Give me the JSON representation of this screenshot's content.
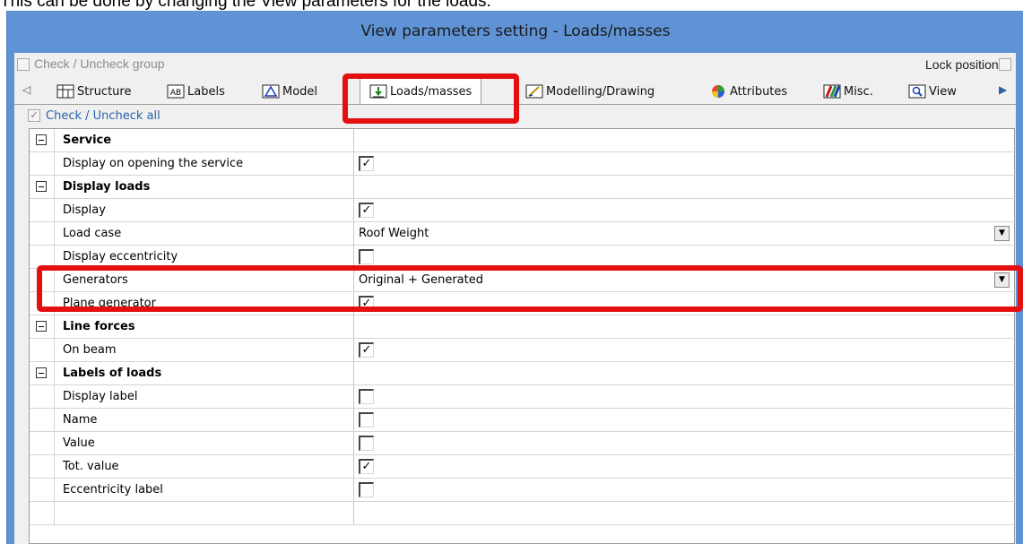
{
  "caption": "This can be done by changing the View parameters for the loads.",
  "window": {
    "title": "View parameters setting - Loads/masses"
  },
  "group_row": {
    "check_group_label": "Check / Uncheck group",
    "lock_label": "Lock position"
  },
  "tabs": [
    {
      "label": "Structure",
      "icon": "structure-icon"
    },
    {
      "label": "Labels",
      "icon": "labels-icon"
    },
    {
      "label": "Model",
      "icon": "model-icon"
    },
    {
      "label": "Loads/masses",
      "icon": "loads-icon",
      "active": true
    },
    {
      "label": "Modelling/Drawing",
      "icon": "modelling-icon"
    },
    {
      "label": "Attributes",
      "icon": "attributes-icon"
    },
    {
      "label": "Misc.",
      "icon": "misc-icon"
    },
    {
      "label": "View",
      "icon": "view-icon"
    }
  ],
  "check_all_label": "Check / Uncheck all",
  "rows": [
    {
      "label": "Service",
      "type": "section"
    },
    {
      "label": "Display on opening the service",
      "type": "checkbox",
      "checked": true
    },
    {
      "label": "Display loads",
      "type": "section"
    },
    {
      "label": "Display",
      "type": "checkbox",
      "checked": true
    },
    {
      "label": "Load case",
      "type": "dropdown",
      "value": "Roof Weight"
    },
    {
      "label": "Display eccentricity",
      "type": "checkbox",
      "checked": false
    },
    {
      "label": "Generators",
      "type": "dropdown",
      "value": "Original + Generated"
    },
    {
      "label": "Plane generator",
      "type": "checkbox",
      "checked": true
    },
    {
      "label": "Line forces",
      "type": "section"
    },
    {
      "label": "On beam",
      "type": "checkbox",
      "checked": true
    },
    {
      "label": "Labels of loads",
      "type": "section"
    },
    {
      "label": "Display label",
      "type": "checkbox",
      "checked": false
    },
    {
      "label": "Name",
      "type": "checkbox",
      "checked": false
    },
    {
      "label": "Value",
      "type": "checkbox",
      "checked": false
    },
    {
      "label": "Tot. value",
      "type": "checkbox",
      "checked": true
    },
    {
      "label": "Eccentricity label",
      "type": "checkbox",
      "checked": false
    }
  ],
  "colors": {
    "window_blue": "#5f93d6",
    "highlight_red": "#e41010",
    "check_all_text": "#2a62a8"
  }
}
